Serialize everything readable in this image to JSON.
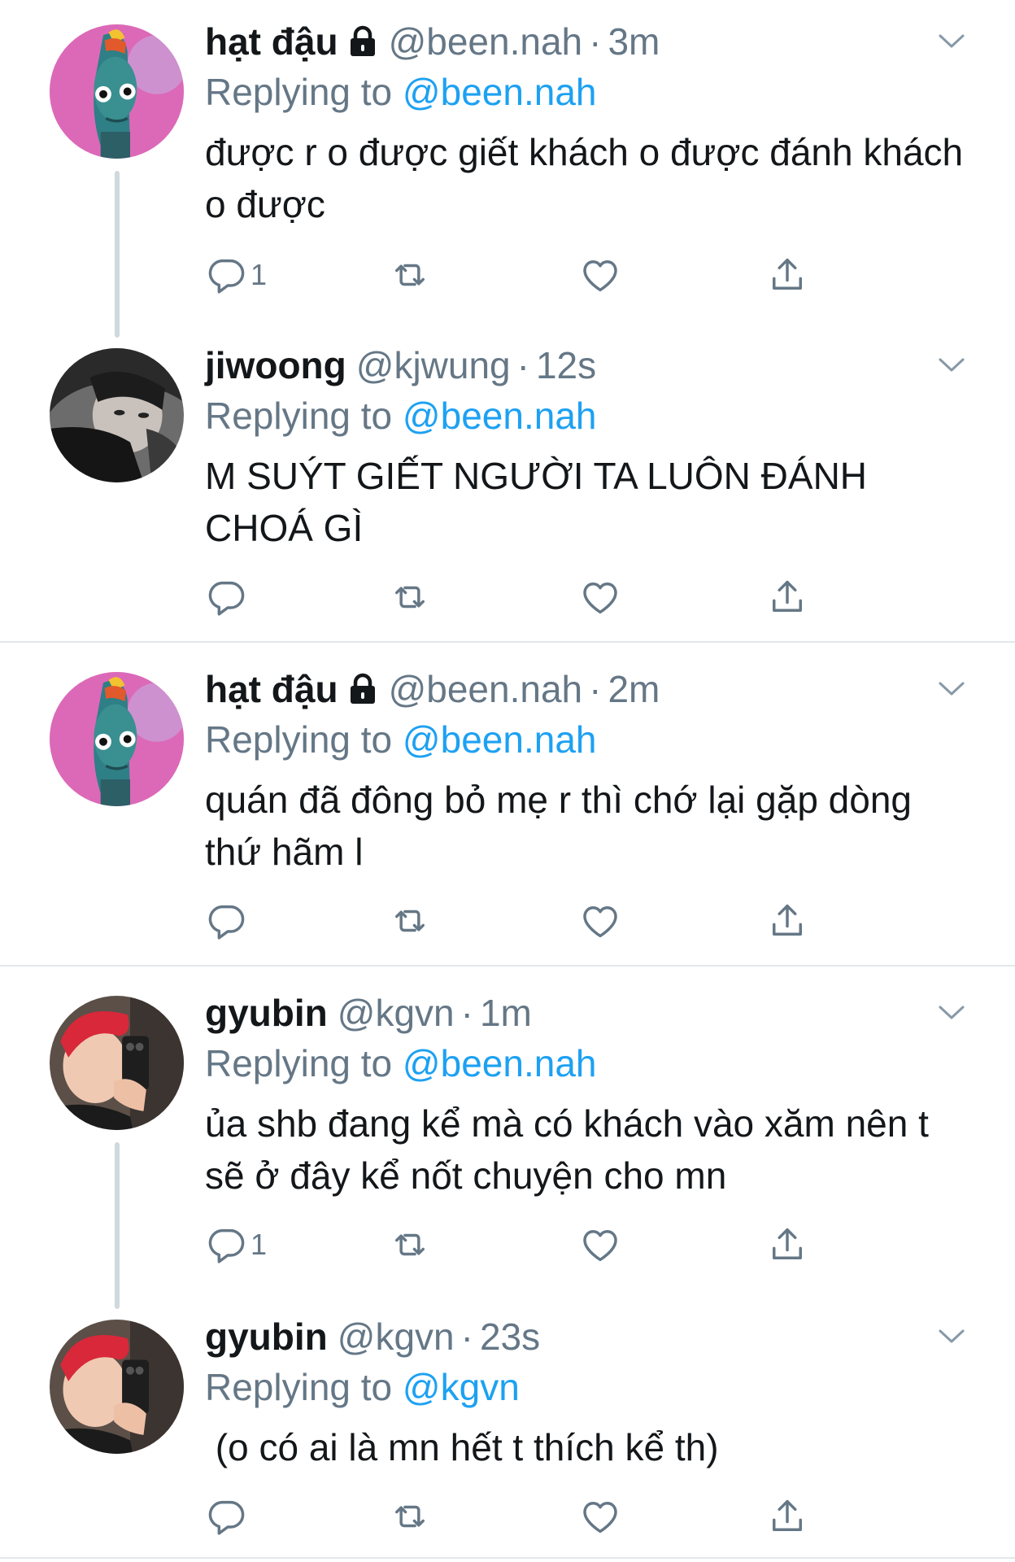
{
  "tweets": [
    {
      "name": "hạt đậu",
      "locked": true,
      "handle": "@been.nah",
      "time": "3m",
      "replying_label": "Replying to",
      "replying_to": "@been.nah",
      "text": "được r o được giết khách o được đánh khách o được",
      "reply_count": "1",
      "avatar": "fish-avatar"
    },
    {
      "name": "jiwoong",
      "locked": false,
      "handle": "@kjwung",
      "time": "12s",
      "replying_label": "Replying to",
      "replying_to": "@been.nah",
      "text": "M SUÝT GIẾT NGƯỜI TA LUÔN ĐÁNH CHOÁ GÌ",
      "reply_count": "",
      "avatar": "person-dark-avatar"
    },
    {
      "name": "hạt đậu",
      "locked": true,
      "handle": "@been.nah",
      "time": "2m",
      "replying_label": "Replying to",
      "replying_to": "@been.nah",
      "text": "quán đã đông bỏ mẹ r thì chớ lại gặp dòng thứ hãm l",
      "reply_count": "",
      "avatar": "fish-avatar"
    },
    {
      "name": "gyubin",
      "locked": false,
      "handle": "@kgvn",
      "time": "1m",
      "replying_label": "Replying to",
      "replying_to": "@been.nah",
      "text": "ủa shb đang kể mà có khách vào xăm nên t sẽ ở đây kể nốt chuyện cho mn",
      "reply_count": "1",
      "avatar": "red-hair-avatar"
    },
    {
      "name": "gyubin",
      "locked": false,
      "handle": "@kgvn",
      "time": "23s",
      "replying_label": "Replying to",
      "replying_to": "@kgvn",
      "text": " (o có ai là mn hết t thích kể th)",
      "reply_count": "",
      "avatar": "red-hair-avatar"
    }
  ],
  "colors": {
    "text": "#14171a",
    "secondary": "#657786",
    "link": "#1da1f2",
    "divider": "#e1e8ed",
    "thread_line": "#cfd9de"
  },
  "icons": [
    "reply-icon",
    "retweet-icon",
    "like-icon",
    "share-icon",
    "chevron-down-icon",
    "lock-icon"
  ]
}
